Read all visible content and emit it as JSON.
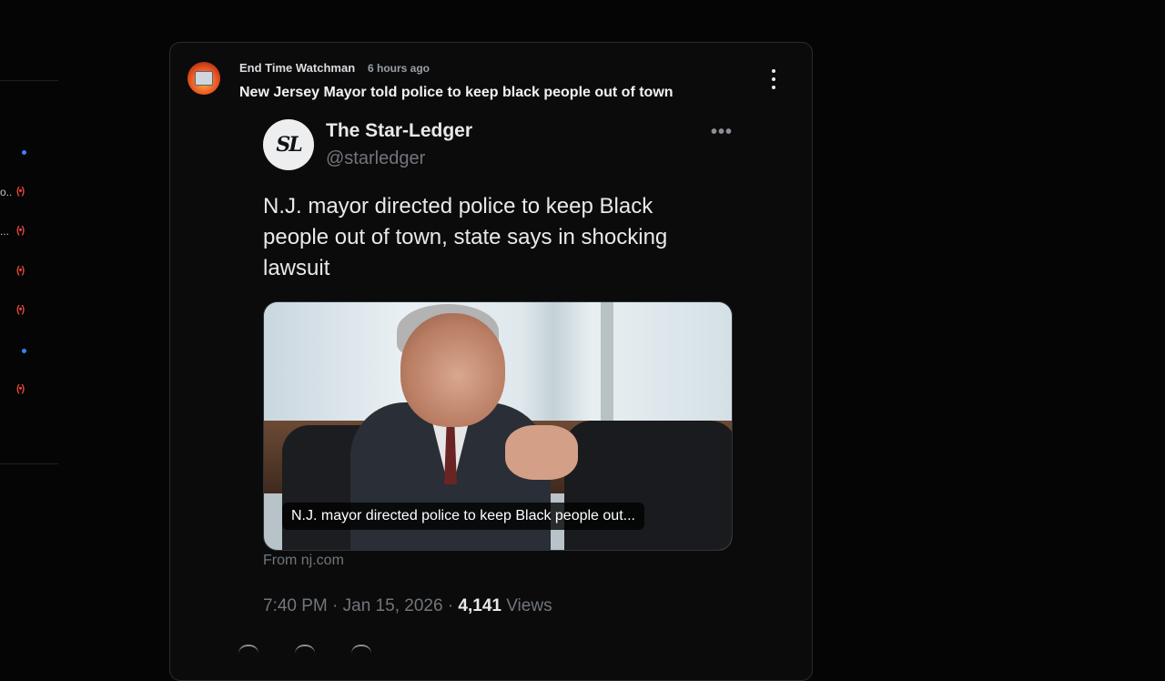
{
  "sidebar": {
    "rows": [
      {
        "text": "",
        "kind": "dot"
      },
      {
        "text": "o...",
        "kind": "live"
      },
      {
        "text": "...",
        "kind": "live"
      },
      {
        "text": "",
        "kind": "live"
      },
      {
        "text": "",
        "kind": "live"
      },
      {
        "text": "",
        "kind": "dot"
      },
      {
        "text": "",
        "kind": "live"
      }
    ],
    "live_glyph": "(•)"
  },
  "post": {
    "author": "End Time Watchman",
    "time": "6 hours ago",
    "title": "New Jersey Mayor told police to keep black people out of town"
  },
  "embed": {
    "logo_text": "SL",
    "name": "The Star-Ledger",
    "handle": "@starledger",
    "more": "•••",
    "text": "N.J. mayor directed police to keep Black people out of town, state says in shocking lawsuit",
    "media_caption": "N.J. mayor directed police to keep Black people out...",
    "from": "From nj.com",
    "timestamp": "7:40 PM · Jan 15, 2026 · ",
    "views_count": "4,141",
    "views_label": " Views"
  },
  "colors": {
    "background": "#050506",
    "card": "#0b0b0c",
    "muted": "#71767b",
    "live_red": "#e0453a",
    "dot_blue": "#3b82f6"
  }
}
